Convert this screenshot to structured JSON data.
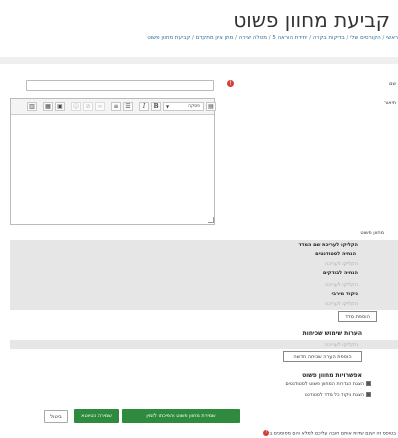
{
  "page": {
    "title": "קביעת מחוון פשוט",
    "breadcrumb": {
      "items": [
        "ראשי",
        "הקורסים שלי",
        "בדיקות בקרה",
        "יחידת הוראה 5",
        "מטלה יצירה",
        "מתן ציון מתקדם",
        "קביעת מחוון פשוט"
      ]
    }
  },
  "form": {
    "name_label": "שם",
    "description_label": "תיאור",
    "editor": {
      "paragraph_select": "פסקה",
      "bold": "B",
      "italic": "I"
    },
    "marking_guide_label": "מחוון פשוט"
  },
  "criteria": {
    "rows": [
      {
        "text": "הקליקו לעריכת שם המדד",
        "style": "bold"
      },
      {
        "text": "הנחיה לסטודנטים",
        "style": "bold"
      },
      {
        "text": "הקליקו לעריכה",
        "style": "ph"
      },
      {
        "text": "הנחיה לבודקים",
        "style": "bold"
      },
      {
        "text": "הקליקו לעריכה",
        "style": "ph"
      },
      {
        "text": "ניקוד מירבי",
        "style": "bold"
      },
      {
        "text": "הקליקו לעריכה",
        "style": "ph"
      }
    ],
    "add_criterion": "הוספת מדד"
  },
  "comments": {
    "heading": "הערות שימוש שכיחות",
    "placeholder": "הקליקו לעריכה",
    "add_comment": "הוספת הערה שכיחה חדשה"
  },
  "options": {
    "heading": "אפשרויות מחוון פשוט",
    "items": [
      "הצגת הגדרות המחוון פשוט לסטודנטים",
      "הצגת ניקוד כל מדד לסטודנט"
    ]
  },
  "buttons": {
    "save_ready": "שמירת מחוון פשוט והפיכתו לזמין",
    "save_draft": "שמירה כטיוטא",
    "cancel": "ביטול"
  },
  "footer": {
    "required_note": "בטופס זה ישנם שדות אותם חובה עליכם למלא והם מסומנים ב"
  }
}
